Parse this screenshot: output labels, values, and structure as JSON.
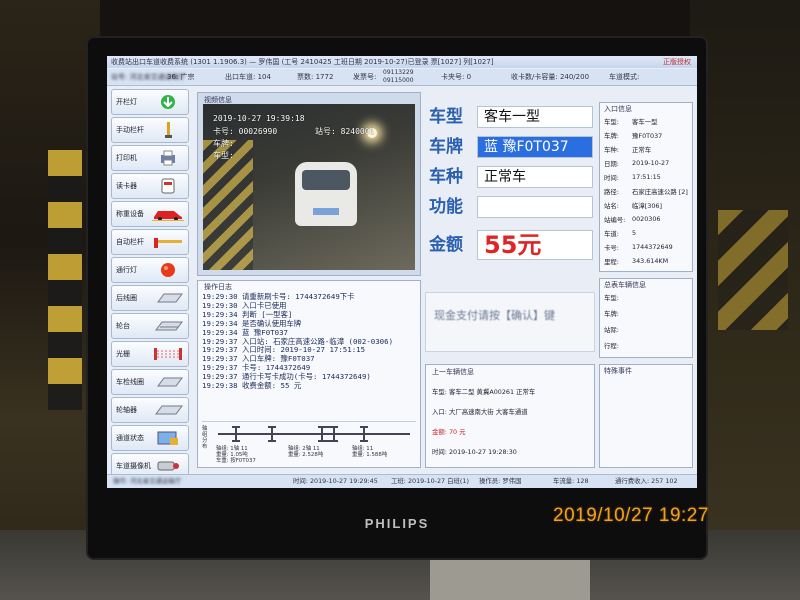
{
  "titlebar": {
    "text": "收费站出口车道收费系统 (1301 1.1906.3) — 罗伟国 (工号 2410425  工班日期 2019-10-27)已登录  票[1027] 列[1027]",
    "right": "正版授权"
  },
  "infobar": {
    "station": "站号: 河北省交通运输厅",
    "plaza": "36: 广宗",
    "lane": "出口车道: 104",
    "ticket": "票数: 1772",
    "card_label": "发票号:",
    "card_value": "09113229 09115000",
    "cardno": "卡夹号: 0",
    "collector": "收卡数/卡容量: 240/200",
    "mode": "车道模式:"
  },
  "buttons": [
    {
      "label": "开栏灯",
      "icon": "green-arrow-icon"
    },
    {
      "label": "手动栏杆",
      "icon": "barrier-pole-icon"
    },
    {
      "label": "打印机",
      "icon": "printer-icon"
    },
    {
      "label": "读卡器",
      "icon": "card-reader-icon"
    },
    {
      "label": "称重设备",
      "icon": "red-car-icon"
    },
    {
      "label": "自动栏杆",
      "icon": "boom-barrier-icon"
    },
    {
      "label": "通行灯",
      "icon": "red-light-icon"
    },
    {
      "label": "后线圈",
      "icon": "coil-icon"
    },
    {
      "label": "轮台",
      "icon": "platform-icon"
    },
    {
      "label": "光栅",
      "icon": "grating-icon"
    },
    {
      "label": "车检线圈",
      "icon": "vehicle-coil-icon"
    },
    {
      "label": "轮轴器",
      "icon": "axle-icon"
    },
    {
      "label": "通道状态",
      "icon": "lane-status-icon"
    },
    {
      "label": "车道摄像机",
      "icon": "camera-icon"
    }
  ],
  "video": {
    "header": "视频信息",
    "overlay_time": "2019-10-27    19:39:18",
    "overlay_card": "卡号: 00026990",
    "overlay_station": "站号: 8240001",
    "overlay_plate": "车牌:",
    "overlay_model": "车型:"
  },
  "log": {
    "header": "操作日志",
    "lines": [
      "19:29:30 请重新刷卡号: 1744372649下卡",
      "19:29:30 入口卡已使用",
      "19:29:34 判断 [一型客]",
      "19:29:34 是否确认使用车牌",
      "19:29:34 蓝 豫F0T037",
      "19:29:37 入口站: 石家庄高速公路-临漳 (002-0306)",
      "19:29:37 入口时间: 2019-10-27 17:51:15",
      "19:29:37 入口车牌: 豫F0T037",
      "19:29:37 卡号: 1744372649",
      "19:29:37 通行卡写卡成功(卡号: 1744372649)",
      "19:29:38 收费金额: 55 元"
    ],
    "diagram_label": "轴组分布",
    "axle_info": [
      "轴组: 1轴 11\n重量: 1.05吨\n车重: 按F0T037",
      "轴组: 2轴 11\n重量: 2.528吨",
      "轴组: 11\n重量: 1.588吨"
    ]
  },
  "vehicle": {
    "type_label": "车型",
    "type_value": "客车一型",
    "plate_label": "车牌",
    "plate_value": "蓝 豫F0T037",
    "kind_label": "车种",
    "kind_value": "正常车",
    "function_label": "功能",
    "function_value": "",
    "amount_label": "金额",
    "amount_value": "55元"
  },
  "cash_prompt": "现金支付请按【确认】键",
  "previous": {
    "header": "上一车辆信息",
    "row1": "车型:  客车二型  黄冀A00261  正常车",
    "row2": "入口: 大厂高速南大街  大客车通道",
    "row3": "金额:  70 元",
    "row4": "时间: 2019-10-27 19:28:30"
  },
  "entry_info": {
    "header": "入口信息",
    "rows": [
      {
        "k": "车型:",
        "v": "客车一型"
      },
      {
        "k": "车牌:",
        "v": "豫F0T037"
      },
      {
        "k": "车种:",
        "v": "正常车"
      },
      {
        "k": "日期:",
        "v": "2019-10-27"
      },
      {
        "k": "时间:",
        "v": "17:51:15"
      },
      {
        "k": "路径:",
        "v": "石家庄高速公路 [2]"
      },
      {
        "k": "站名:",
        "v": "临漳[306]"
      },
      {
        "k": "站编号:",
        "v": "0020306"
      },
      {
        "k": "车道:",
        "v": "5"
      },
      {
        "k": "卡号:",
        "v": "1744372649"
      },
      {
        "k": "里程:",
        "v": "343.614KM"
      }
    ]
  },
  "pass_info": {
    "header": "总表车辆信息",
    "rows": [
      {
        "k": "车型:"
      },
      {
        "k": "车牌:"
      },
      {
        "k": "站际:"
      },
      {
        "k": "行程:"
      }
    ]
  },
  "special": {
    "header": "特殊事件"
  },
  "statusbar": {
    "left": "操作: 河北省交通运输厅",
    "time": "时间: 2019-10-27 19:29:45",
    "shift": "工班: 2019-10-27  白班(1)",
    "operator": "操作员: 罗伟国",
    "flow": "车流量: 128",
    "fee": "通行费收入: 257 102"
  },
  "monitor_brand": "PHILIPS",
  "photo_timestamp": "2019/10/27 19:27"
}
